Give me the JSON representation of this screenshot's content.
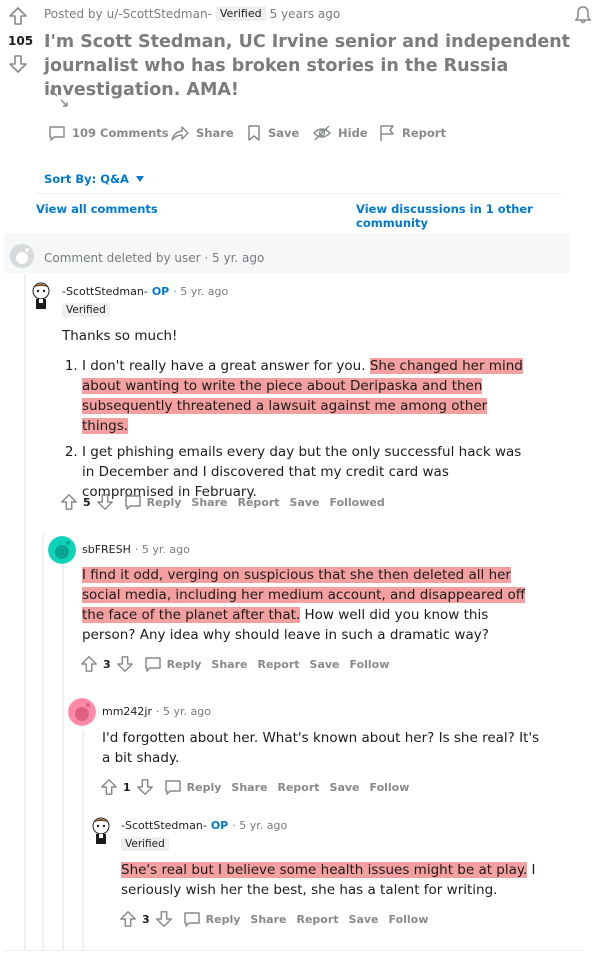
{
  "post": {
    "posted_by_prefix": "Posted by",
    "poster": "u/-ScottStedman-",
    "verified": "Verified",
    "age": "5 years ago",
    "score": "105",
    "title": "I'm Scott Stedman, UC Irvine senior and independent journalist who has broken stories in the Russia investigation. AMA!",
    "actions": {
      "comments": "109 Comments",
      "share": "Share",
      "save": "Save",
      "hide": "Hide",
      "report": "Report"
    },
    "sort_label": "Sort By: Q&A",
    "view_all": "View all comments",
    "view_other": "View discussions in 1 other community"
  },
  "comments": {
    "deleted": {
      "text": "Comment deleted by user",
      "age": "· 5 yr. ago"
    },
    "c1": {
      "author": "-ScottStedman-",
      "op": "OP",
      "age": "· 5 yr. ago",
      "badge": "Verified",
      "intro": "Thanks so much!",
      "item1_plain": "I don't really have a great answer for you. ",
      "item1_hl": "She changed her mind about wanting to write the piece about Deripaska and then subsequently threatened a lawsuit against me among other things.",
      "item2": "I get phishing emails every day but the only successful hack was in December and I discovered that my credit card was compromised in February.",
      "votes": "5",
      "reply": "Reply",
      "share": "Share",
      "report": "Report",
      "save": "Save",
      "follow": "Followed"
    },
    "c2": {
      "author": "sbFRESH",
      "age": "· 5 yr. ago",
      "text_hl": "I find it odd, verging on suspicious that she then deleted all her social media, including her medium account, and disappeared off the face of the planet after that.",
      "text_plain": " How well did you know this person? Any idea why should leave in such a dramatic way?",
      "votes": "3",
      "reply": "Reply",
      "share": "Share",
      "report": "Report",
      "save": "Save",
      "follow": "Follow"
    },
    "c3": {
      "author": "mm242jr",
      "age": "· 5 yr. ago",
      "text": "I'd forgotten about her. What's known about her? Is she real? It's a bit shady.",
      "votes": "1",
      "reply": "Reply",
      "share": "Share",
      "report": "Report",
      "save": "Save",
      "follow": "Follow"
    },
    "c4": {
      "author": "-ScottStedman-",
      "op": "OP",
      "age": "· 5 yr. ago",
      "badge": "Verified",
      "text_hl": "She's real but I believe some health issues might be at play.",
      "text_plain": " I seriously wish her the best, she has a talent for writing.",
      "votes": "3",
      "reply": "Reply",
      "share": "Share",
      "report": "Report",
      "save": "Save",
      "follow": "Follow"
    }
  },
  "colors": {
    "highlight": "#f4a0a0",
    "blue": "#0079d3",
    "gray": "#878a8c",
    "avatar_teal": "#0dd3bb",
    "avatar_pink": "#ff8aa8"
  }
}
